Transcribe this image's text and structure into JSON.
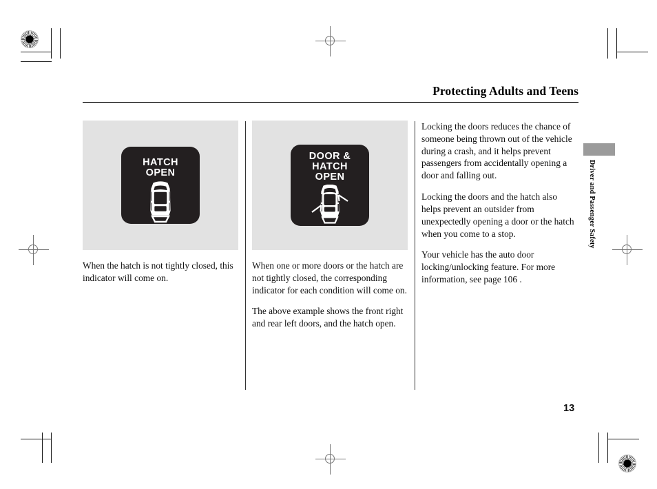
{
  "document": {
    "header_title": "Protecting Adults and Teens",
    "page_number": "13",
    "side_tab_label": "Driver and Passenger Safety"
  },
  "figures": [
    {
      "name": "hatch-open-indicator",
      "indicator_label": "HATCH\nOPEN",
      "icon": "car-top-view-hatch-open-icon",
      "background_color": "#e2e2e2",
      "display_color": "#231f20",
      "text_color": "#ffffff"
    },
    {
      "name": "door-and-hatch-open-indicator",
      "indicator_label": "DOOR &\nHATCH\nOPEN",
      "icon": "car-top-view-doors-and-hatch-open-icon",
      "background_color": "#e2e2e2",
      "display_color": "#231f20",
      "text_color": "#ffffff"
    }
  ],
  "columns": {
    "column_1": {
      "paragraphs": [
        "When the hatch is not tightly closed, this indicator will come on."
      ]
    },
    "column_2": {
      "paragraphs": [
        "When one or more doors or the hatch are not tightly closed, the corresponding indicator for each condition will come on.",
        "The above example shows the front right and rear left doors, and the hatch open."
      ]
    },
    "column_3": {
      "paragraphs": [
        "Locking the doors reduces the chance of someone being thrown out of the vehicle during a crash, and it helps prevent passengers from accidentally opening a door and falling out.",
        "Locking the doors and the hatch also helps prevent an outsider from unexpectedly opening a door or the hatch when you come to a stop.",
        "Your vehicle has the auto door locking/unlocking feature. For more information, see page 106 ."
      ]
    }
  }
}
